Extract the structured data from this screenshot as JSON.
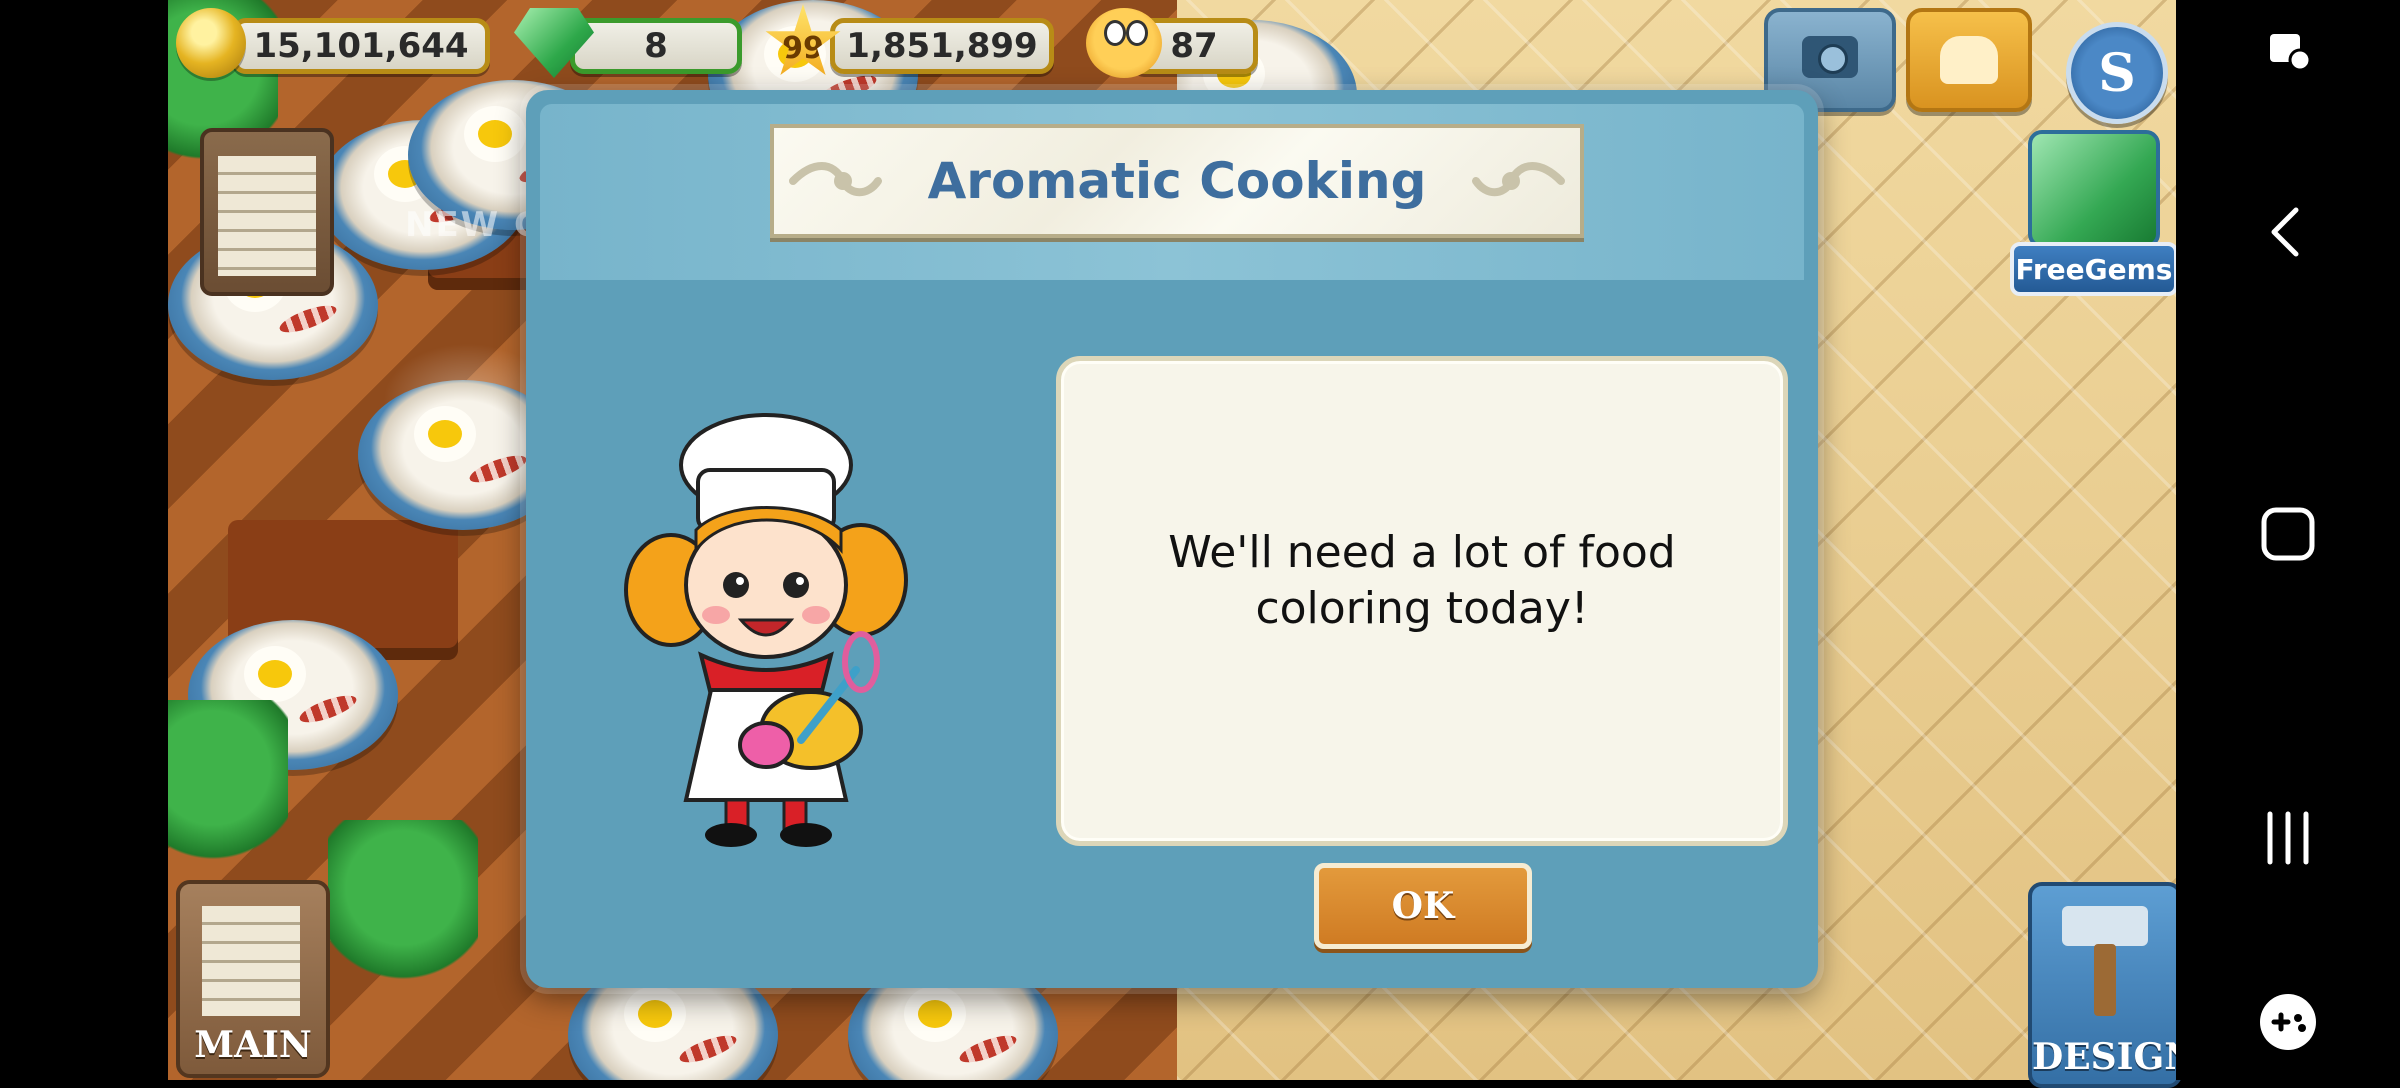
{
  "hud": {
    "coins": "15,101,644",
    "gems": "8",
    "level": "99",
    "experience": "1,851,899",
    "customers": "87"
  },
  "buttons": {
    "free_gems_label": "FreeGems",
    "main_label": "MAIN",
    "design_label": "DESIGN",
    "new_banner": "NEW G"
  },
  "dialog": {
    "title": "Aromatic Cooking",
    "message": "We'll need a lot of food\ncoloring today!",
    "ok_label": "OK"
  },
  "icons": {
    "currency": "coin-icon",
    "premium": "gem-icon",
    "level": "star-icon",
    "customers": "face-icon"
  },
  "colors": {
    "dialog_bg": "#5e9fb9",
    "title_text": "#3e6e9e",
    "ok_button": "#cf7b23"
  }
}
